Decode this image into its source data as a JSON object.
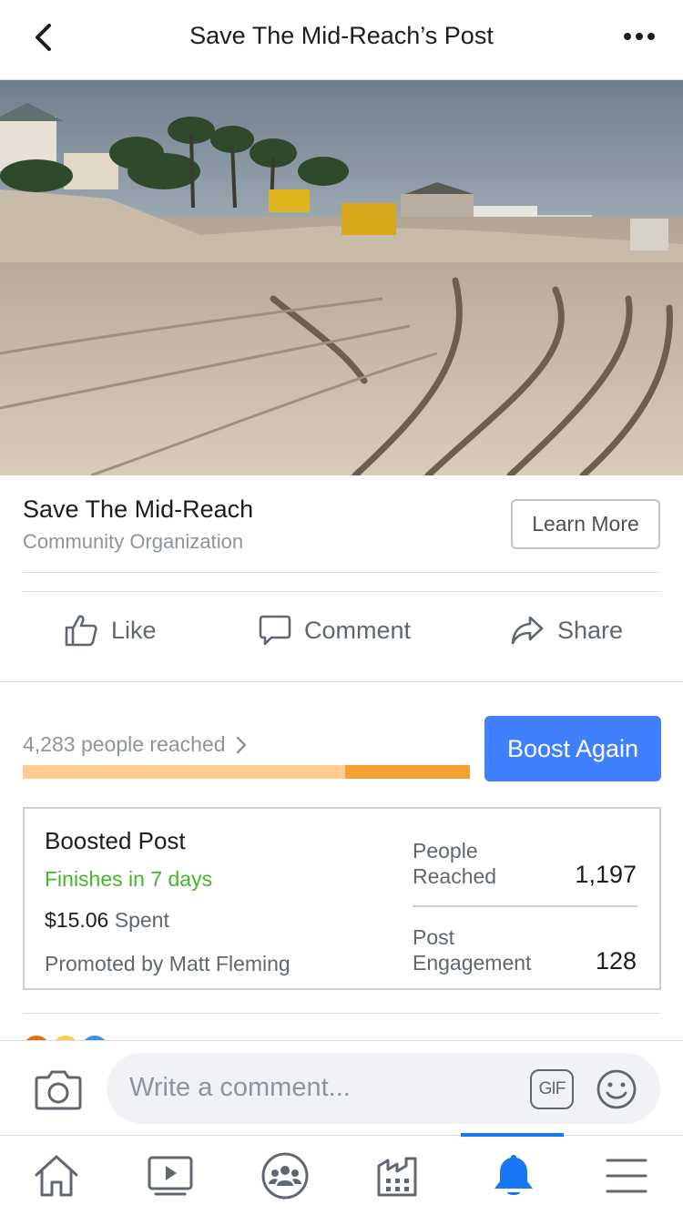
{
  "header": {
    "title": "Save The Mid-Reach’s Post",
    "back_icon": "chevron-left-icon",
    "more_icon": "more-dots-icon"
  },
  "photo": {
    "description_icon": "beach-photo"
  },
  "page": {
    "name": "Save The Mid-Reach",
    "category": "Community Organization",
    "cta_label": "Learn More"
  },
  "actions": {
    "like": "Like",
    "comment": "Comment",
    "share": "Share"
  },
  "reach": {
    "label": "4,283 people reached",
    "organic_fraction": 0.72,
    "paid_fraction": 0.28,
    "boost_label": "Boost Again"
  },
  "boosted": {
    "title": "Boosted Post",
    "finishes": "Finishes in 7 days",
    "spent_amount": "$15.06",
    "spent_label": "Spent",
    "promoted_by": "Promoted by Matt Fleming",
    "stats": [
      {
        "label": "People Reached",
        "value": "1,197"
      },
      {
        "label": "Post Engagement",
        "value": "128"
      }
    ]
  },
  "composer": {
    "placeholder": "Write a comment...",
    "gif_label": "GIF"
  },
  "tabs": [
    {
      "name": "home",
      "icon": "home-icon"
    },
    {
      "name": "watch",
      "icon": "video-icon"
    },
    {
      "name": "groups",
      "icon": "groups-icon"
    },
    {
      "name": "marketplace",
      "icon": "marketplace-icon"
    },
    {
      "name": "notifications",
      "icon": "bell-icon",
      "active": true
    },
    {
      "name": "menu",
      "icon": "menu-icon"
    }
  ],
  "colors": {
    "accent": "#4080ff",
    "green": "#42b72a",
    "bar_light": "#ffcd8f",
    "bar_dark": "#f7a034",
    "active_tab": "#1877f2"
  }
}
